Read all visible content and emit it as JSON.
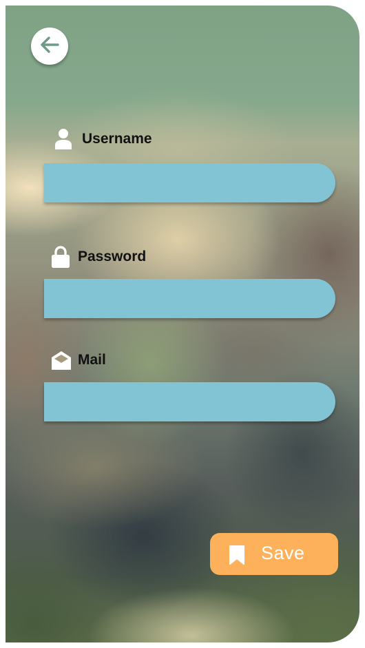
{
  "header": {
    "back_icon": "arrow-left-icon"
  },
  "form": {
    "username": {
      "label": "Username",
      "icon": "user-icon",
      "value": "",
      "placeholder": ""
    },
    "password": {
      "label": "Password",
      "icon": "lock-icon",
      "value": "",
      "placeholder": ""
    },
    "mail": {
      "label": "Mail",
      "icon": "mail-icon",
      "value": "",
      "placeholder": ""
    }
  },
  "actions": {
    "save_label": "Save",
    "save_icon": "bookmark-icon"
  },
  "colors": {
    "input_background": "#82c4d4",
    "save_button": "#fdb15a",
    "back_arrow": "#6f9a86"
  }
}
